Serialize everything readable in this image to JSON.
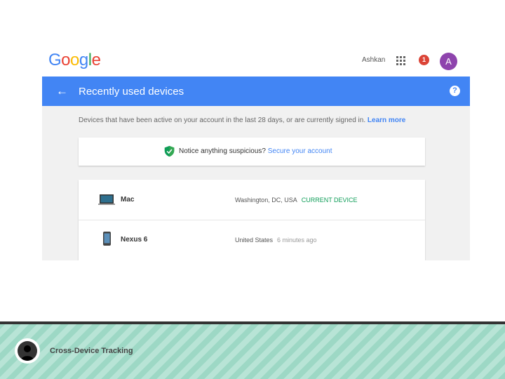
{
  "header": {
    "logo_letters": [
      "G",
      "o",
      "o",
      "g",
      "l",
      "e"
    ],
    "logo_colors": [
      "#4285f4",
      "#ea4335",
      "#fbbc05",
      "#4285f4",
      "#34a853",
      "#ea4335"
    ],
    "username": "Ashkan",
    "notification_count": "1",
    "avatar_letter": "A"
  },
  "page": {
    "title": "Recently used devices",
    "back_icon": "back-arrow-icon",
    "help_icon": "help-icon",
    "description": "Devices that have been active on your account in the last 28 days, or are currently signed in.",
    "learn_more": "Learn more"
  },
  "alert": {
    "text": "Notice anything suspicious?",
    "link": "Secure your account",
    "icon": "shield-icon"
  },
  "devices": [
    {
      "name": "Mac",
      "location": "Washington, DC, USA",
      "status": "CURRENT DEVICE",
      "icon": "laptop-icon"
    },
    {
      "name": "Nexus 6",
      "location": "United States",
      "status": "6 minutes ago",
      "icon": "phone-icon"
    }
  ],
  "footer": {
    "title": "Cross-Device Tracking",
    "icon": "person-icon"
  },
  "colors": {
    "brand_blue": "#4285f4",
    "current_green": "#0f9d58",
    "notification_red": "#db4437",
    "avatar_purple": "#8e44ad"
  }
}
